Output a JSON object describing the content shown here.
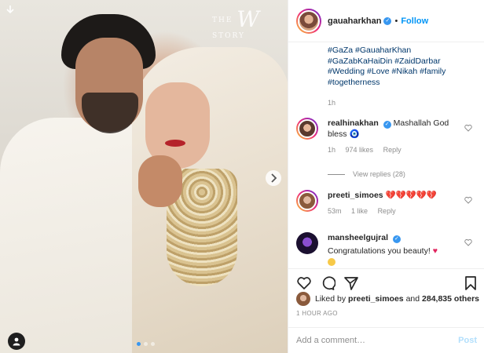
{
  "photo": {
    "watermark_small": "THE",
    "watermark_big": "W",
    "watermark_end": "STORY",
    "carousel_dots": 3,
    "active_dot": 0
  },
  "header": {
    "username": "gauaharkhan",
    "separator": "•",
    "follow_label": "Follow"
  },
  "caption": {
    "hashtags": "#GaZa #GauaharKhan #GaZabKaHaiDin #ZaidDarbar #Wedding #Love #Nikah #family #togetherness",
    "time": "1h"
  },
  "comments": [
    {
      "username": "realhinakhan",
      "verified": true,
      "text": "Mashallah God bless",
      "emoji": "🧿",
      "time": "1h",
      "likes": "974 likes",
      "reply": "Reply"
    },
    {
      "username": "preeti_simoes",
      "verified": false,
      "text": "💔💔💔💔💔",
      "time": "53m",
      "likes": "1 like",
      "reply": "Reply"
    },
    {
      "username": "mansheelgujral",
      "verified": true,
      "text": "Congratulations you beauty!"
    }
  ],
  "view_replies": "View replies (28)",
  "likes": {
    "prefix": "Liked by",
    "user": "preeti_simoes",
    "middle": "and",
    "count": "284,835 others"
  },
  "timeago": "1 HOUR AGO",
  "add_comment": {
    "placeholder": "Add a comment…",
    "post_label": "Post"
  },
  "colors": {
    "link_blue": "#0095f6",
    "hashtag": "#00376b",
    "muted": "#8e8e8e",
    "heart_red": "#e0245e"
  }
}
